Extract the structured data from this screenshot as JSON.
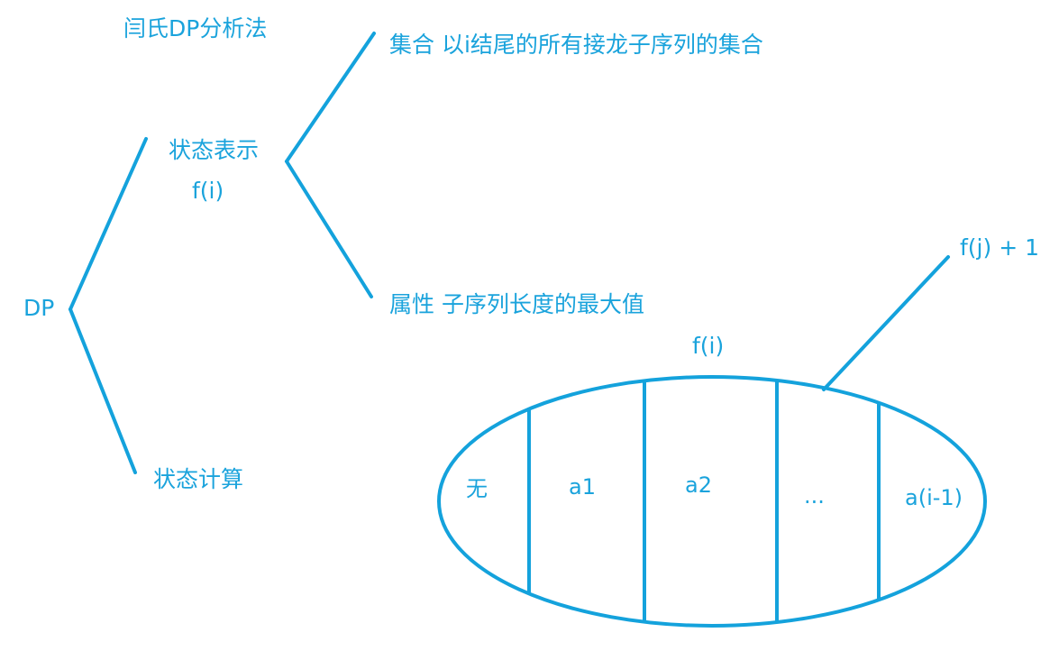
{
  "colors": {
    "stroke": "#14a2dc",
    "text": "#1aa3dc",
    "background": "#ffffff"
  },
  "diagram": {
    "title": "闫氏DP分析法",
    "root": "DP",
    "state_representation": {
      "label": "状态表示",
      "function": "f(i)",
      "set": "集合   以i结尾的所有接龙子序列的集合",
      "attribute": "属性  子序列长度的最大值"
    },
    "state_computation": {
      "label": "状态计算"
    },
    "partition": {
      "title": "f(i)",
      "sections": [
        "无",
        "a1",
        "a2",
        "...",
        "a(i-1)"
      ],
      "transition": "f(j)  + 1"
    }
  }
}
